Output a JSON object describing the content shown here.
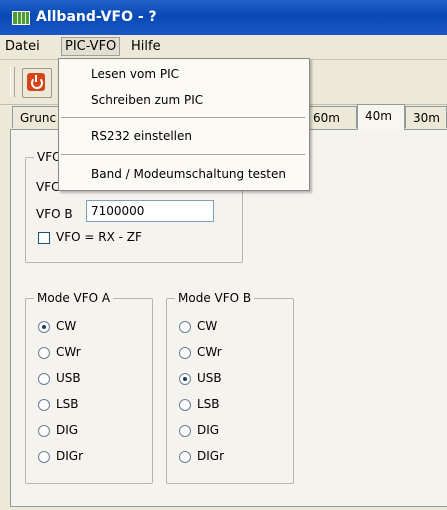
{
  "window": {
    "title": "Allband-VFO - ?"
  },
  "menubar": {
    "items": [
      "Datei",
      "PIC-VFO",
      "Hilfe"
    ]
  },
  "dropdown": {
    "items": [
      "Lesen vom PIC",
      "Schreiben zum PIC",
      "RS232 einstellen",
      "Band / Modeumschaltung testen"
    ]
  },
  "tabs": {
    "items": [
      "Grunc",
      "60m",
      "40m",
      "30m"
    ],
    "selected": "40m"
  },
  "vfo_group": {
    "legend": "VFO",
    "vfo_a_label": "VFC",
    "vfo_b_label": "VFO B",
    "vfo_b_value": "7100000",
    "checkbox_label": "VFO = RX - ZF"
  },
  "mode_a": {
    "legend": "Mode VFO A",
    "options": [
      "CW",
      "CWr",
      "USB",
      "LSB",
      "DIG",
      "DIGr"
    ],
    "selected": "CW"
  },
  "mode_b": {
    "legend": "Mode VFO B",
    "options": [
      "CW",
      "CWr",
      "USB",
      "LSB",
      "DIG",
      "DIGr"
    ],
    "selected": "USB"
  }
}
